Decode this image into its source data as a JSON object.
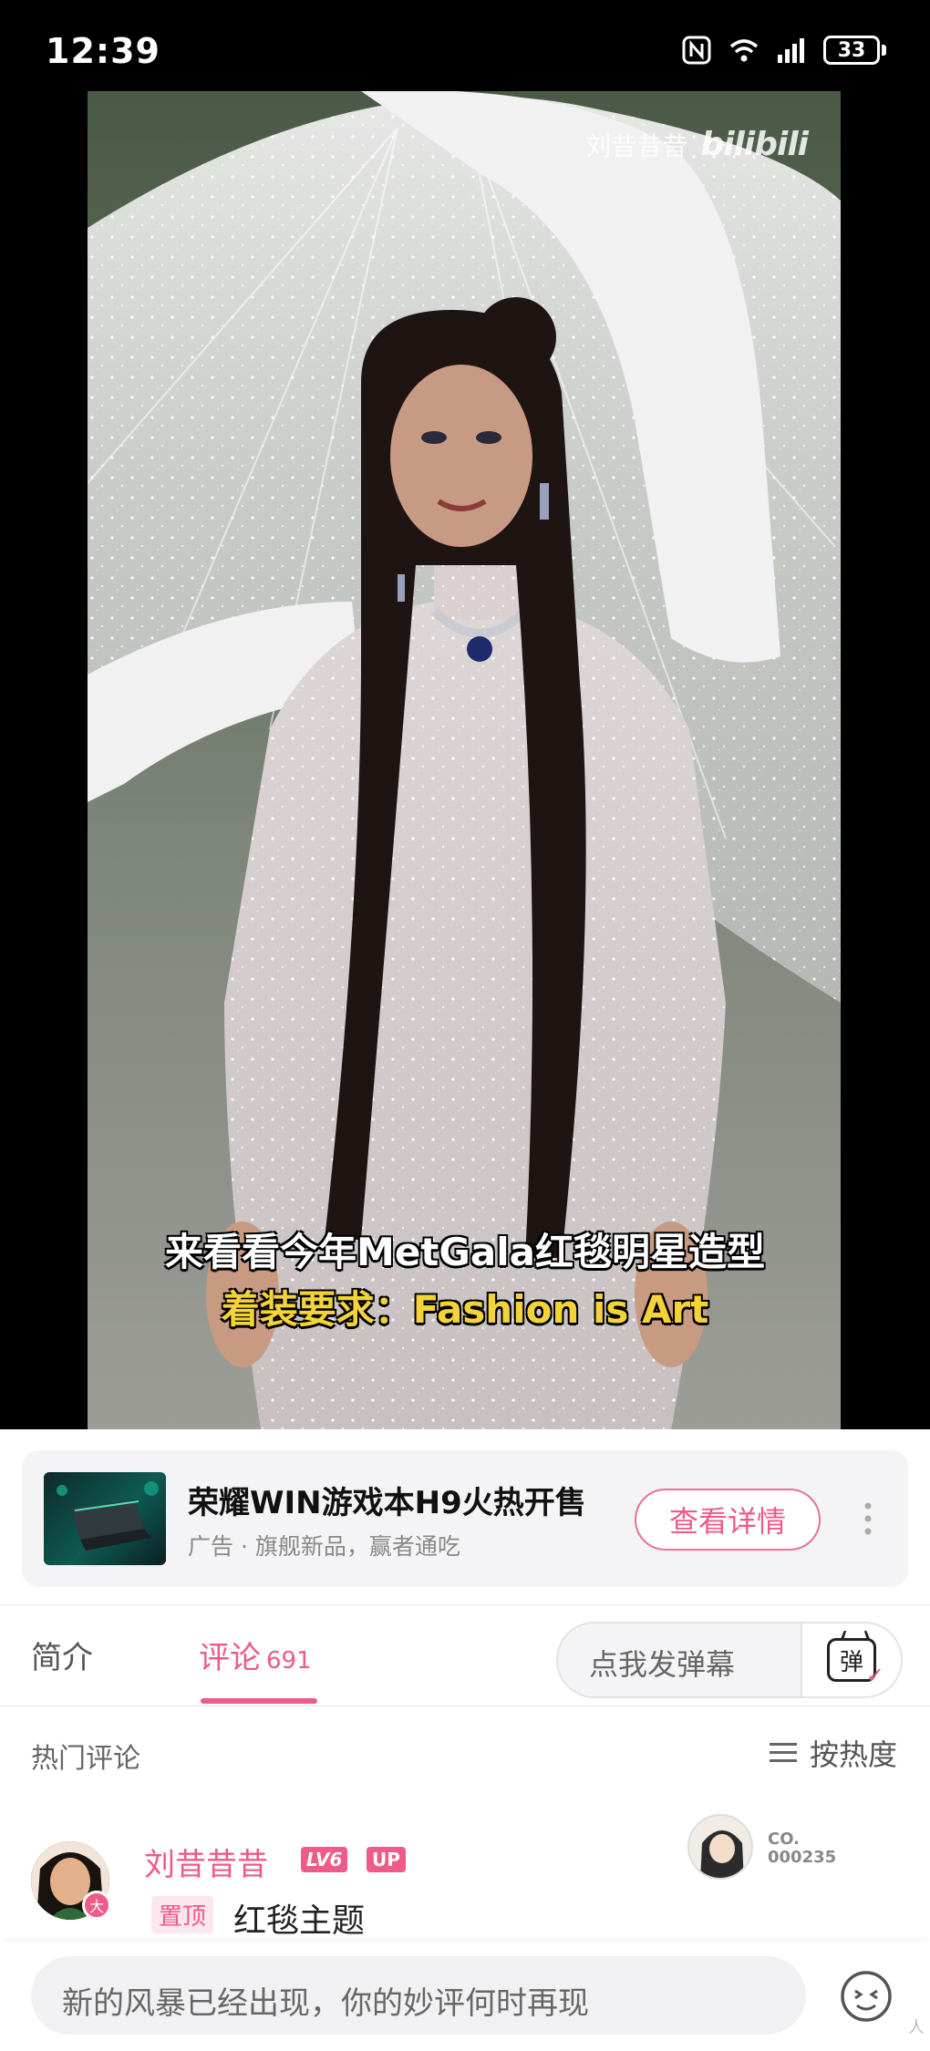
{
  "status_bar": {
    "time": "12:39",
    "battery": "33",
    "icons": [
      "nfc-icon",
      "wifi-icon",
      "signal-icon",
      "battery-icon"
    ]
  },
  "video": {
    "watermark_name": "刘昔昔昔",
    "watermark_logo": "bilibili",
    "subtitle_line1": "来看看今年MetGala红毯明星造型",
    "subtitle_line2": "着装要求：Fashion is Art"
  },
  "ad": {
    "title": "荣耀WIN游戏本H9火热开售",
    "subtitle": "广告 · 旗舰新品，赢者通吃",
    "button_label": "查看详情"
  },
  "tabs": {
    "intro": "简介",
    "comments": "评论",
    "comments_count": "691",
    "danmaku_placeholder": "点我发弹幕",
    "danmaku_toggle": "弹"
  },
  "comments_header": {
    "title": "热门评论",
    "sort_label": "按热度"
  },
  "comment": {
    "user": "刘昔昔昔",
    "level": "LV6",
    "up_badge": "UP",
    "avatar_badge": "大",
    "pinned": "置顶",
    "text": "红毯主题",
    "fan_label": "CO.\n000235"
  },
  "bottom": {
    "reply_placeholder": "新的风暴已经出现，你的妙评何时再现",
    "edge_text": "人"
  },
  "colors": {
    "accent": "#ef5a88",
    "subtitle_yellow": "#f3d337"
  }
}
